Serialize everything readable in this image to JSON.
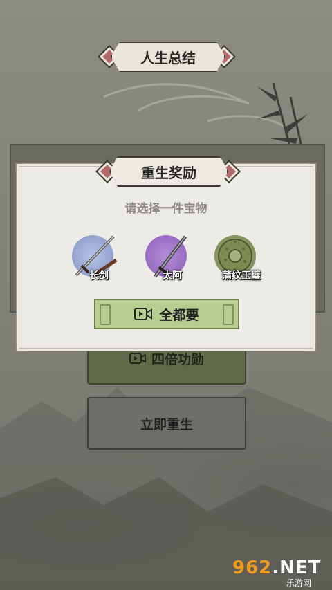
{
  "summary_title": "人生总结",
  "dialog": {
    "title": "重生奖励",
    "subtitle": "请选择一件宝物",
    "items": [
      {
        "label": "长剑",
        "color": "#9fb0d8",
        "icon": "sword-icon"
      },
      {
        "label": "太阿",
        "color": "#a07bc4",
        "icon": "sword-icon"
      },
      {
        "label": "蒲纹玉璧",
        "color": "#8fa06a",
        "icon": "jade-disc-icon"
      }
    ],
    "take_all_label": "全都要"
  },
  "buttons": {
    "quadruple_label": "四倍功勋",
    "rebirth_label": "立即重生"
  },
  "watermark": {
    "main_prefix": "962",
    "main_suffix": ".NET",
    "sub": "乐游网"
  },
  "colors": {
    "accent_green": "#b7cc8f",
    "diamond_red": "#b36a68"
  }
}
